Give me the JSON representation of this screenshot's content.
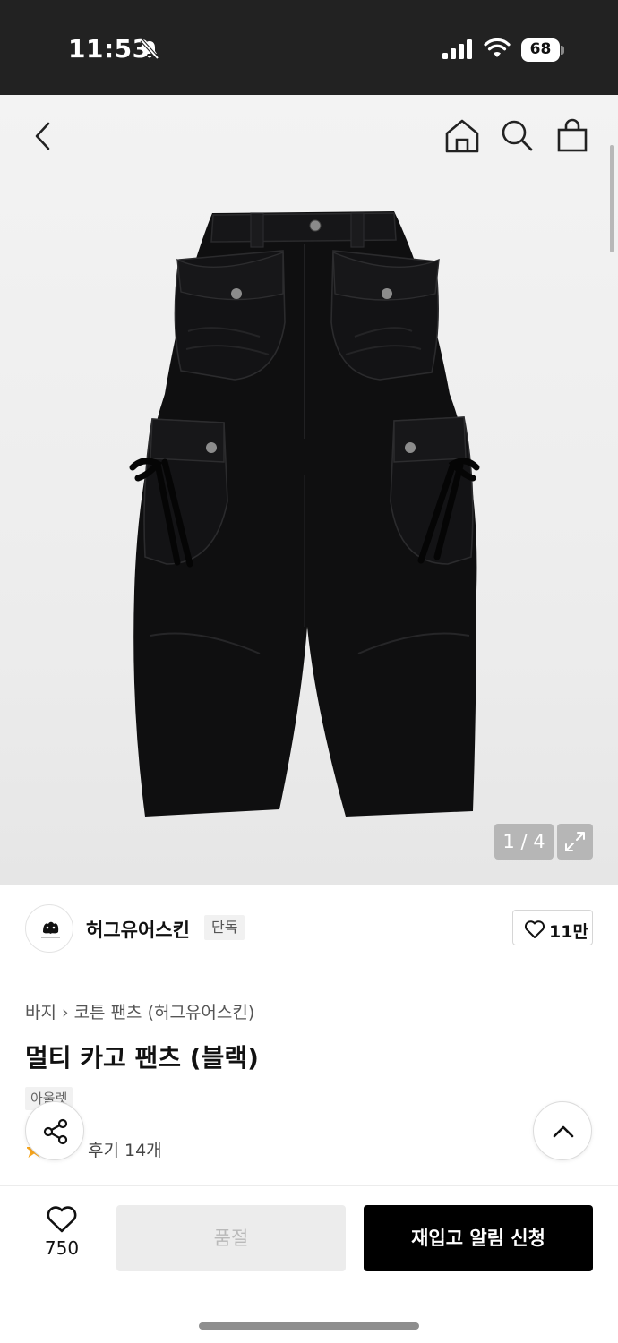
{
  "status_bar": {
    "time": "11:53",
    "battery": "68"
  },
  "colors": {
    "accent": "#000000",
    "disabled": "#ececec",
    "header": "#222222",
    "star": "#f7a51c"
  },
  "icons": {
    "back": "chevron-left-icon",
    "home": "home-icon",
    "search": "search-icon",
    "cart": "shopping-bag-icon",
    "expand": "expand-icon",
    "like": "heart-icon",
    "share": "share-icon",
    "scroll_top": "chevron-up-icon"
  },
  "gallery": {
    "counter": "1 / 4"
  },
  "brand": {
    "name": "허그유어스킨",
    "tag": "단독",
    "likes": "11만"
  },
  "breadcrumb": {
    "category": "바지",
    "sub": "코튼 팬츠 (허그유어스킨)"
  },
  "product": {
    "title": "멀티 카고 팬츠 (블랙)",
    "badge": "아울렛",
    "reviews": "후기 14개"
  },
  "bottom_bar": {
    "wish_count": "750",
    "soldout_label": "품절",
    "restock_label": "재입고 알림 신청"
  }
}
